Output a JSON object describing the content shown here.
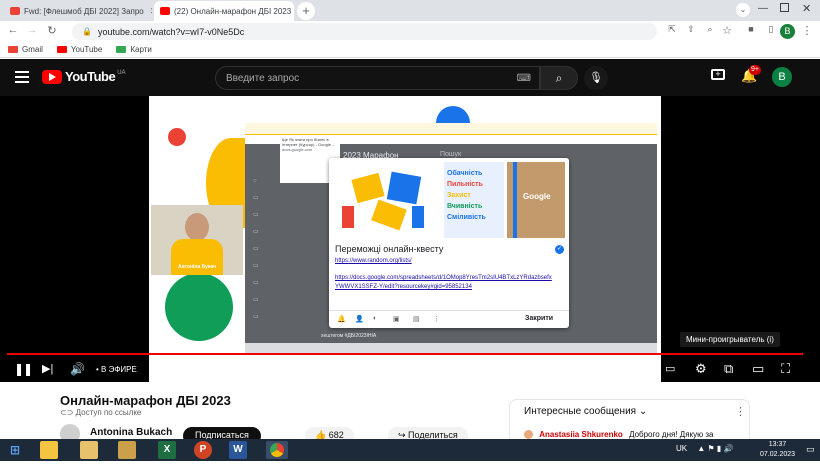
{
  "browser": {
    "tabs": [
      {
        "title": "Fwd: [Флешмоб ДБІ 2022] Запро",
        "favicon_color": "#ea4335"
      },
      {
        "title": "(22) Онлайн-марафон ДБІ 2023",
        "favicon_color": "#ff0000"
      }
    ],
    "url": "youtube.com/watch?v=wI7-v0Ne5Dc",
    "bookmarks": [
      {
        "label": "Gmail",
        "icon": "gmail-icon",
        "color": "#ea4335"
      },
      {
        "label": "YouTube",
        "icon": "youtube-icon",
        "color": "#ff0000"
      },
      {
        "label": "Карти",
        "icon": "maps-icon",
        "color": "#34a853"
      }
    ],
    "profile_initial": "B"
  },
  "youtube": {
    "logo_text": "YouTube",
    "logo_region": "UA",
    "search_placeholder": "Введите запрос",
    "notification_count": "9+",
    "avatar_initial": "B"
  },
  "slide": {
    "inner_title": "2023 Марафон",
    "inner_search": "Пошук",
    "popup_url_title": "Ще Як знати про бізнес в Інтернет (Курсор) - Google ...",
    "popup_url_sub": "docs.google.com",
    "card_title": "Переможці онлайн-квесту",
    "card_link1": "https://www.random.org/lists/",
    "card_link2": "https://docs.google.com/spreadsheets/d/1OMop8YresTm2sIU4BTxLzYRdazbsefxYWWVX1SSFZ-Y/edit?resourcekey#gid=95852134",
    "card_close": "Закрити",
    "values_text": [
      "Обачність",
      "Пильність",
      "Захист",
      "Вчивність",
      "Сміливість"
    ],
    "values_colors": [
      "#1a73e8",
      "#ea4335",
      "#fbbc04",
      "#0f9d58",
      "#1a73e8"
    ],
    "notebook_text": "Google",
    "webcam_name": "Антоніна Букач",
    "hashtag_text": "хештегом #ДБІ2023ІНІА"
  },
  "player": {
    "live_label": "• В ЭФИРЕ",
    "miniplayer_tooltip": "Мини-проигрыватель (i)"
  },
  "video": {
    "title": "Онлайн-марафон ДБІ 2023",
    "privacy": "Доступ по ссылке",
    "channel": "Antonina Bukach",
    "subscribe": "Подписаться",
    "likes": "682",
    "share": "Поделиться"
  },
  "chat": {
    "header": "Интересные сообщения",
    "first_author": "Anastasiia Shkurenko",
    "first_message": "Доброго дня! Дякую за"
  },
  "taskbar": {
    "lang": "UK",
    "time": "13:37",
    "date": "07.02.2023"
  }
}
